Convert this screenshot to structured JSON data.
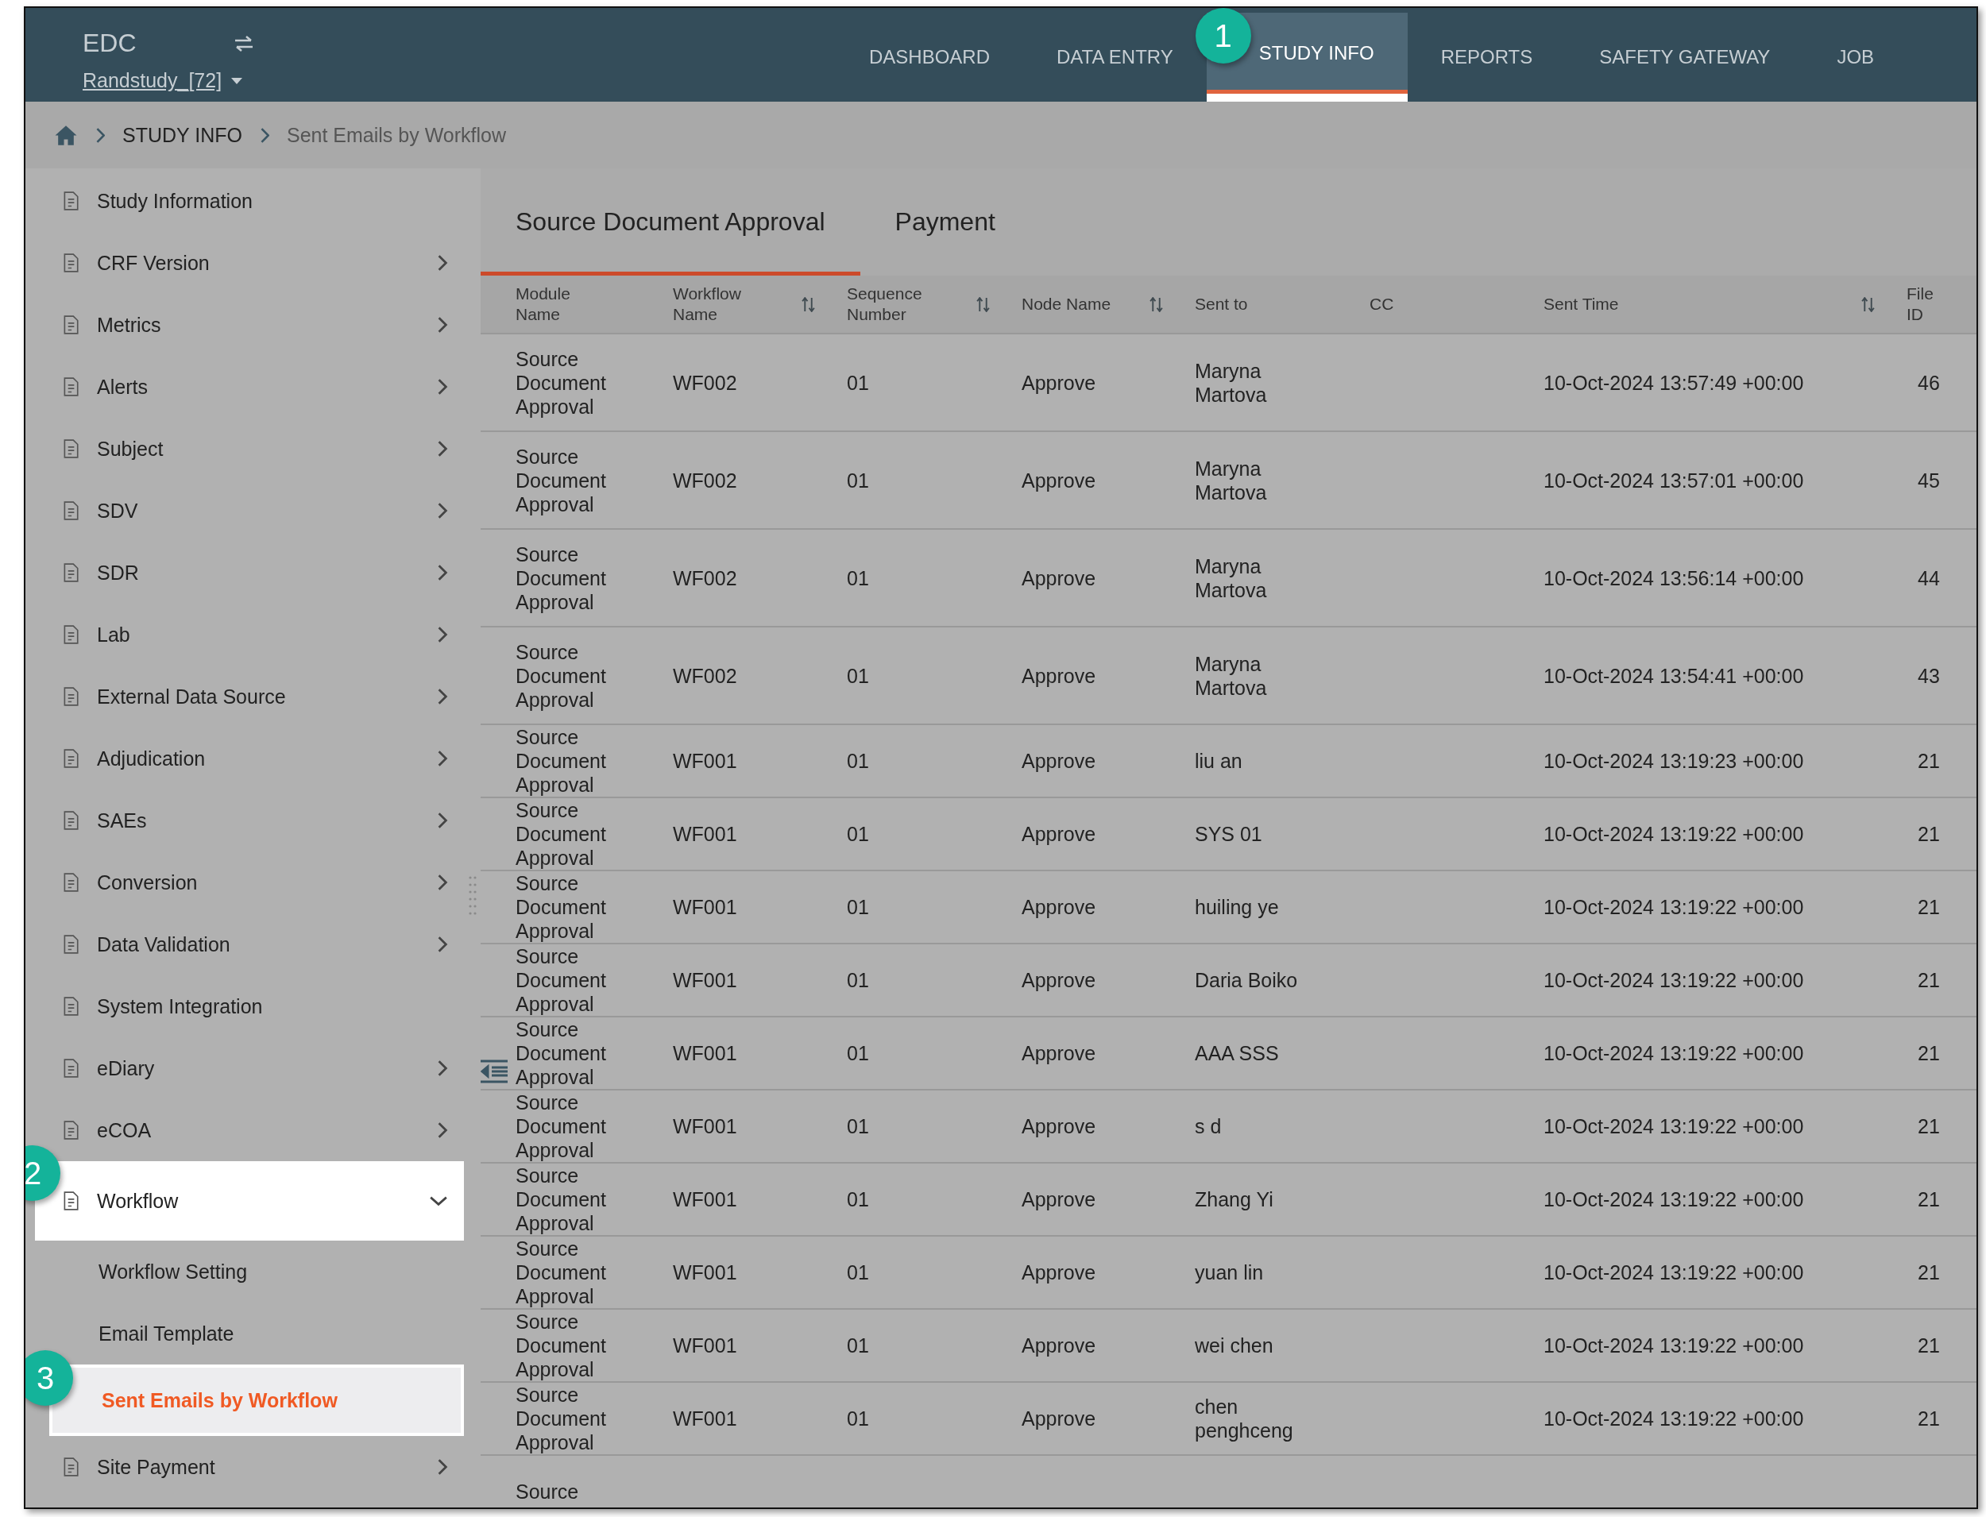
{
  "header": {
    "logo": "EDC",
    "study": "Randstudy_[72]",
    "nav": [
      {
        "label": "DASHBOARD",
        "selected": false
      },
      {
        "label": "DATA ENTRY",
        "selected": false
      },
      {
        "label": "STUDY INFO",
        "selected": true,
        "callout": "1"
      },
      {
        "label": "REPORTS",
        "selected": false
      },
      {
        "label": "SAFETY GATEWAY",
        "selected": false
      },
      {
        "label": "JOB",
        "selected": false
      }
    ]
  },
  "breadcrumb": [
    "STUDY INFO",
    "Sent Emails by Workflow"
  ],
  "sidebar": {
    "items": [
      {
        "label": "Study Information",
        "selected": false
      },
      {
        "label": "CRF Version",
        "selected": false,
        "expanded": false
      },
      {
        "label": "Metrics",
        "selected": false,
        "expanded": false
      },
      {
        "label": "Alerts",
        "selected": false,
        "expanded": false
      },
      {
        "label": "Subject",
        "selected": false,
        "expanded": false
      },
      {
        "label": "SDV",
        "selected": false,
        "expanded": false
      },
      {
        "label": "SDR",
        "selected": false,
        "expanded": false
      },
      {
        "label": "Lab",
        "selected": false,
        "expanded": false
      },
      {
        "label": "External Data Source",
        "selected": false,
        "expanded": false
      },
      {
        "label": "Adjudication",
        "selected": false,
        "expanded": false
      },
      {
        "label": "SAEs",
        "selected": false,
        "expanded": false
      },
      {
        "label": "Conversion",
        "selected": false,
        "expanded": false
      },
      {
        "label": "Data Validation",
        "selected": false,
        "expanded": false
      },
      {
        "label": "System Integration",
        "selected": false
      },
      {
        "label": "eDiary",
        "selected": false,
        "expanded": false
      },
      {
        "label": "eCOA",
        "selected": false,
        "expanded": false
      },
      {
        "label": "Workflow",
        "selected": false,
        "expanded": true,
        "callout": "2",
        "children": [
          {
            "label": "Workflow Setting",
            "selected": false
          },
          {
            "label": "Email Template",
            "selected": false
          },
          {
            "label": "Sent Emails by Workflow",
            "selected": true,
            "callout": "3"
          }
        ]
      },
      {
        "label": "Site Payment",
        "selected": false,
        "expanded": false
      }
    ]
  },
  "tabs": [
    {
      "label": "Source Document Approval",
      "selected": true
    },
    {
      "label": "Payment",
      "selected": false
    }
  ],
  "table": {
    "columns": [
      {
        "label": "Module Name",
        "sortable": false
      },
      {
        "label": "Workflow Name",
        "sortable": true
      },
      {
        "label": "Sequence Number",
        "sortable": true
      },
      {
        "label": "Node Name",
        "sortable": true
      },
      {
        "label": "Sent to",
        "sortable": false
      },
      {
        "label": "CC",
        "sortable": false
      },
      {
        "label": "Sent Time",
        "sortable": true
      },
      {
        "label": "File ID",
        "sortable": false
      }
    ],
    "rows": [
      [
        "Source Document Approval",
        "WF002",
        "01",
        "Approve",
        "Maryna Martova",
        "",
        "10-Oct-2024 13:57:49 +00:00",
        "46"
      ],
      [
        "Source Document Approval",
        "WF002",
        "01",
        "Approve",
        "Maryna Martova",
        "",
        "10-Oct-2024 13:57:01 +00:00",
        "45"
      ],
      [
        "Source Document Approval",
        "WF002",
        "01",
        "Approve",
        "Maryna Martova",
        "",
        "10-Oct-2024 13:56:14 +00:00",
        "44"
      ],
      [
        "Source Document Approval",
        "WF002",
        "01",
        "Approve",
        "Maryna Martova",
        "",
        "10-Oct-2024 13:54:41 +00:00",
        "43"
      ],
      [
        "Source Document Approval",
        "WF001",
        "01",
        "Approve",
        "liu an",
        "",
        "10-Oct-2024 13:19:23 +00:00",
        "21"
      ],
      [
        "Source Document Approval",
        "WF001",
        "01",
        "Approve",
        "SYS 01",
        "",
        "10-Oct-2024 13:19:22 +00:00",
        "21"
      ],
      [
        "Source Document Approval",
        "WF001",
        "01",
        "Approve",
        "huiling ye",
        "",
        "10-Oct-2024 13:19:22 +00:00",
        "21"
      ],
      [
        "Source Document Approval",
        "WF001",
        "01",
        "Approve",
        "Daria Boiko",
        "",
        "10-Oct-2024 13:19:22 +00:00",
        "21"
      ],
      [
        "Source Document Approval",
        "WF001",
        "01",
        "Approve",
        "AAA SSS",
        "",
        "10-Oct-2024 13:19:22 +00:00",
        "21"
      ],
      [
        "Source Document Approval",
        "WF001",
        "01",
        "Approve",
        "s d",
        "",
        "10-Oct-2024 13:19:22 +00:00",
        "21"
      ],
      [
        "Source Document Approval",
        "WF001",
        "01",
        "Approve",
        "Zhang Yi",
        "",
        "10-Oct-2024 13:19:22 +00:00",
        "21"
      ],
      [
        "Source Document Approval",
        "WF001",
        "01",
        "Approve",
        "yuan lin",
        "",
        "10-Oct-2024 13:19:22 +00:00",
        "21"
      ],
      [
        "Source Document Approval",
        "WF001",
        "01",
        "Approve",
        "wei chen",
        "",
        "10-Oct-2024 13:19:22 +00:00",
        "21"
      ],
      [
        "Source Document Approval",
        "WF001",
        "01",
        "Approve",
        "chen penghceng",
        "",
        "10-Oct-2024 13:19:22 +00:00",
        "21"
      ],
      [
        "Source"
      ]
    ]
  }
}
